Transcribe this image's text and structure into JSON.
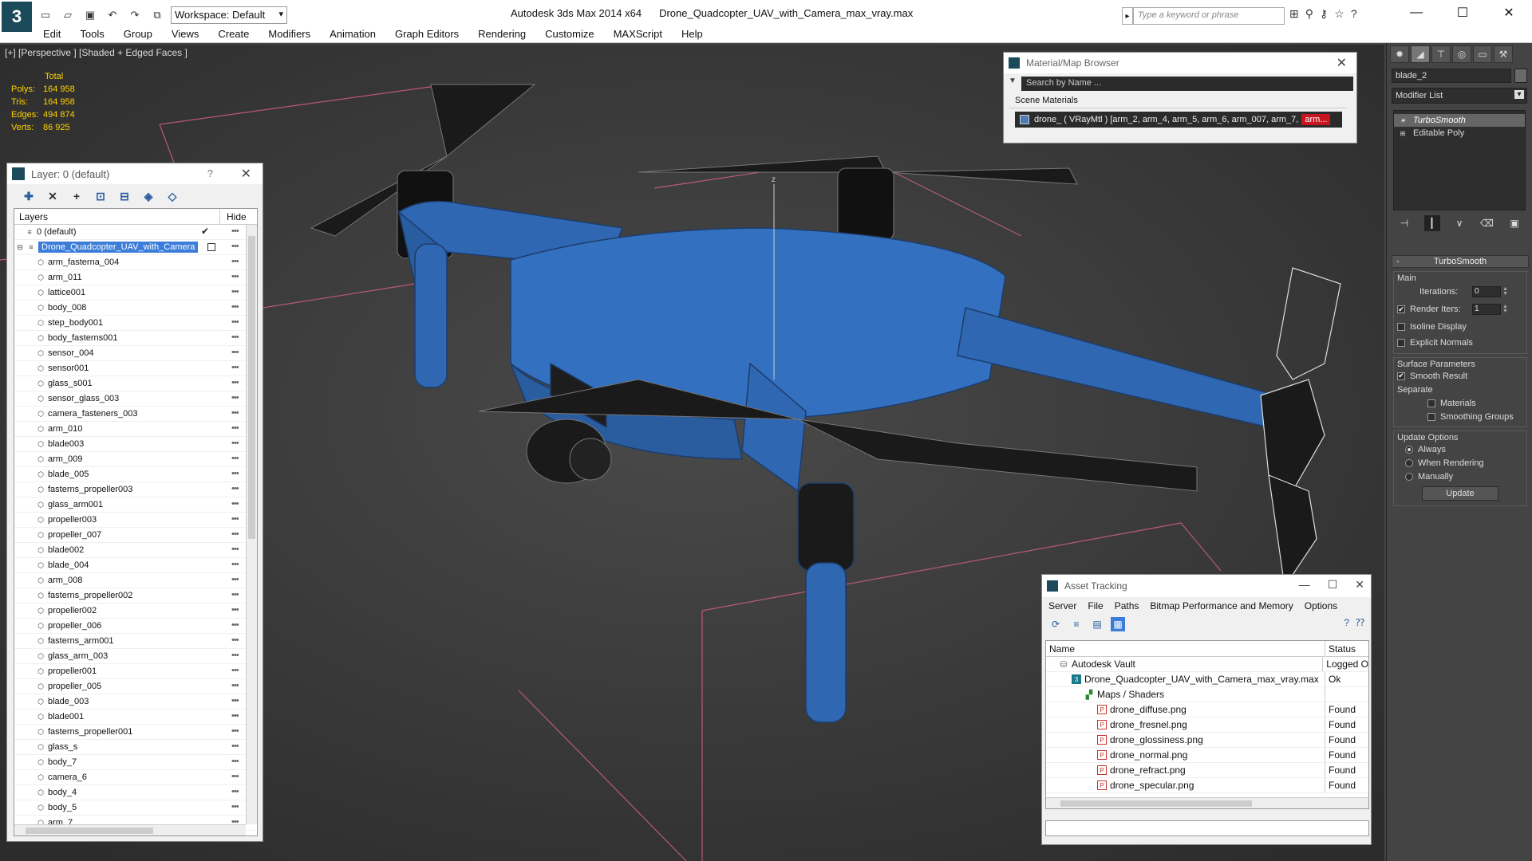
{
  "app": {
    "logo_glyph": "3",
    "title_app": "Autodesk 3ds Max  2014 x64",
    "title_file": "Drone_Quadcopter_UAV_with_Camera_max_vray.max",
    "workspace": "Workspace: Default",
    "search_placeholder": "Type a keyword or phrase"
  },
  "menu": [
    "Edit",
    "Tools",
    "Group",
    "Views",
    "Create",
    "Modifiers",
    "Animation",
    "Graph Editors",
    "Rendering",
    "Customize",
    "MAXScript",
    "Help"
  ],
  "viewport": {
    "label": "[+] [Perspective ] [Shaded + Edged Faces ]",
    "stats": {
      "header": "Total",
      "rows": [
        {
          "k": "Polys:",
          "v": "164 958"
        },
        {
          "k": "Tris:",
          "v": "164 958"
        },
        {
          "k": "Edges:",
          "v": "494 874"
        },
        {
          "k": "Verts:",
          "v": "86 925"
        }
      ]
    },
    "axis_label": "z",
    "colors": {
      "model": "#2f67b3",
      "grid": "#d0607c",
      "wire": "#151515"
    }
  },
  "layers": {
    "title": "Layer: 0 (default)",
    "help": "?",
    "col_layers": "Layers",
    "col_hide": "Hide",
    "default_layer": "0 (default)",
    "selected_layer": "Drone_Quadcopter_UAV_with_Camera",
    "items": [
      "arm_fasterna_004",
      "arm_011",
      "lattice001",
      "body_008",
      "step_body001",
      "body_fasterns001",
      "sensor_004",
      "sensor001",
      "glass_s001",
      "sensor_glass_003",
      "camera_fasteners_003",
      "arm_010",
      "blade003",
      "arm_009",
      "blade_005",
      "fasterns_propeller003",
      "glass_arm001",
      "propeller003",
      "propeller_007",
      "blade002",
      "blade_004",
      "arm_008",
      "fasterns_propeller002",
      "propeller002",
      "propeller_006",
      "fasterns_arm001",
      "glass_arm_003",
      "propeller001",
      "propeller_005",
      "blade_003",
      "blade001",
      "fasterns_propeller001",
      "glass_s",
      "body_7",
      "camera_6",
      "body_4",
      "body_5",
      "arm_7"
    ]
  },
  "material_browser": {
    "title": "Material/Map Browser",
    "search": "Search by Name ...",
    "section": "Scene Materials",
    "entry": "drone_  ( VRayMtl )  [arm_2, arm_4, arm_5, arm_6, arm_007, arm_7,",
    "entry_tail": "arm..."
  },
  "asset_tracking": {
    "title": "Asset Tracking",
    "menu": [
      "Server",
      "File",
      "Paths",
      "Bitmap Performance and Memory",
      "Options"
    ],
    "col_name": "Name",
    "col_status": "Status",
    "rows": [
      {
        "name": "Autodesk Vault",
        "status": "Logged O",
        "indent": 1,
        "icon": "vault"
      },
      {
        "name": "Drone_Quadcopter_UAV_with_Camera_max_vray.max",
        "status": "Ok",
        "indent": 2,
        "icon": "max"
      },
      {
        "name": "Maps / Shaders",
        "status": "",
        "indent": 3,
        "icon": "maps"
      },
      {
        "name": "drone_diffuse.png",
        "status": "Found",
        "indent": 4,
        "icon": "png"
      },
      {
        "name": "drone_fresnel.png",
        "status": "Found",
        "indent": 4,
        "icon": "png"
      },
      {
        "name": "drone_glossiness.png",
        "status": "Found",
        "indent": 4,
        "icon": "png"
      },
      {
        "name": "drone_normal.png",
        "status": "Found",
        "indent": 4,
        "icon": "png"
      },
      {
        "name": "drone_refract.png",
        "status": "Found",
        "indent": 4,
        "icon": "png"
      },
      {
        "name": "drone_specular.png",
        "status": "Found",
        "indent": 4,
        "icon": "png"
      }
    ]
  },
  "command_panel": {
    "object_name": "blade_2",
    "modifier_list": "Modifier List",
    "stack": [
      "TurboSmooth",
      "Editable Poly"
    ],
    "rollout_title": "TurboSmooth",
    "main_label": "Main",
    "iterations_label": "Iterations:",
    "iterations_value": "0",
    "render_iters_label": "Render Iters:",
    "render_iters_value": "1",
    "isoline": "Isoline Display",
    "explicit_normals": "Explicit Normals",
    "surface_params": "Surface Parameters",
    "smooth_result": "Smooth Result",
    "separate": "Separate",
    "materials": "Materials",
    "smoothing_groups": "Smoothing Groups",
    "update_options": "Update Options",
    "always": "Always",
    "when_rendering": "When Rendering",
    "manually": "Manually",
    "update_button": "Update"
  }
}
